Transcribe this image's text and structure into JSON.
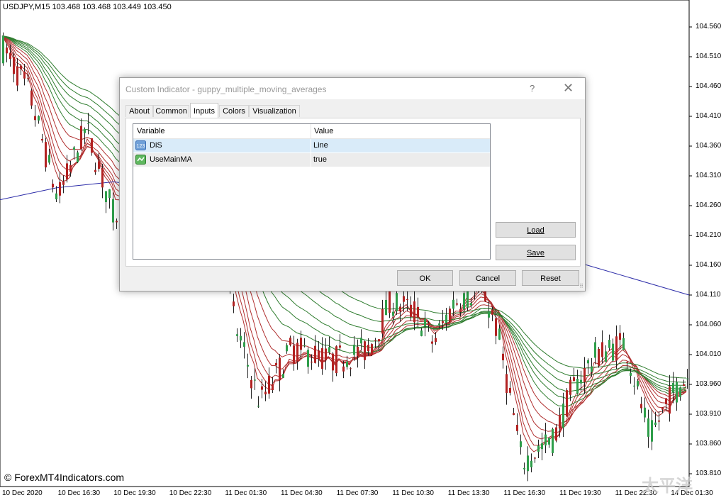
{
  "chart": {
    "symbol_header": "USDJPY,M15  103.468 103.468 103.449 103.450",
    "price_ticks": [
      "104.560",
      "104.510",
      "104.460",
      "104.410",
      "104.360",
      "104.310",
      "104.260",
      "104.210",
      "104.160",
      "104.110",
      "104.060",
      "104.010",
      "103.960",
      "103.910",
      "103.860",
      "103.810"
    ],
    "time_ticks": [
      "10 Dec 2020",
      "10 Dec 16:30",
      "10 Dec 19:30",
      "10 Dec 22:30",
      "11 Dec 01:30",
      "11 Dec 04:30",
      "11 Dec 07:30",
      "11 Dec 10:30",
      "11 Dec 13:30",
      "11 Dec 16:30",
      "11 Dec 19:30",
      "11 Dec 22:30",
      "14 Dec 01:30"
    ],
    "watermark": "© ForexMT4Indicators.com",
    "logo_text": "太平洋",
    "colors": {
      "bull": "#2e9e4a",
      "bear": "#b22222",
      "slow_ma": "#2f7d2f",
      "fast_ma": "#b03030",
      "main_ma": "#2b2ba8"
    }
  },
  "dialog": {
    "title": "Custom Indicator - guppy_multiple_moving_averages",
    "help": "?",
    "close": "✕",
    "tabs": [
      "About",
      "Common",
      "Inputs",
      "Colors",
      "Visualization"
    ],
    "active_tab": "Inputs",
    "table": {
      "headers": [
        "Variable",
        "Value"
      ],
      "rows": [
        {
          "name": "DiS",
          "value": "Line",
          "icon": "int-123-icon"
        },
        {
          "name": "UseMainMA",
          "value": "true",
          "icon": "bool-icon"
        }
      ]
    },
    "buttons": {
      "load": "Load",
      "save": "Save",
      "ok": "OK",
      "cancel": "Cancel",
      "reset": "Reset"
    }
  }
}
